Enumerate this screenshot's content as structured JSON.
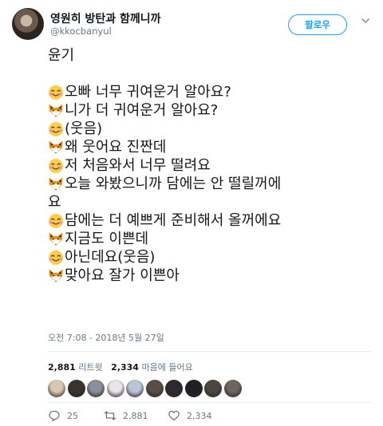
{
  "user": {
    "display_name": "영원히 방탄과 함께니까",
    "handle": "@kkocbanyul",
    "follow_label": "팔로우"
  },
  "tweet": {
    "lines": [
      {
        "icon": "",
        "text": "윤기"
      },
      {
        "icon": "",
        "text": ""
      },
      {
        "icon": "smiling-face-icon",
        "text": "오빠 너무 귀여운거 알아요?"
      },
      {
        "icon": "fox-face-icon",
        "text": "니가 더 귀여운거 알아요?"
      },
      {
        "icon": "smiling-face-icon",
        "text": "(웃음)"
      },
      {
        "icon": "fox-face-icon",
        "text": "왜 웃어요 진짠데"
      },
      {
        "icon": "smiling-face-icon",
        "text": "저 처음와서 너무 떨려요"
      },
      {
        "icon": "fox-face-icon",
        "text": "오늘 와봤으니까 담에는 안 떨릴꺼에"
      },
      {
        "icon": "",
        "text": "요"
      },
      {
        "icon": "smiling-face-icon",
        "text": "담에는 더 예쁘게 준비해서 올꺼에요"
      },
      {
        "icon": "fox-face-icon",
        "text": "지금도 이쁜데"
      },
      {
        "icon": "smiling-face-icon",
        "text": "아닌데요(웃음)"
      },
      {
        "icon": "fox-face-icon",
        "text": "맞아요 잘가 이쁜아"
      }
    ],
    "timestamp": "오전 7:08 - 2018년 5월 27일"
  },
  "stats": {
    "retweet_count": "2,881",
    "retweet_label": "리트윗",
    "like_count": "2,334",
    "like_label": "마음에 들어요"
  },
  "likers": [
    {
      "color": "#d9c7b3"
    },
    {
      "color": "#3b3330"
    },
    {
      "color": "#8a8f9c"
    },
    {
      "color": "#e9e4e8"
    },
    {
      "color": "#b9c6d8"
    },
    {
      "color": "#5c4d44"
    },
    {
      "color": "#2c2a30"
    },
    {
      "color": "#1f1f24"
    },
    {
      "color": "#4d4540"
    },
    {
      "color": "#6e6560"
    }
  ],
  "actions": {
    "reply_count": "25",
    "retweet_count": "2,881",
    "like_count": "2,334"
  },
  "colors": {
    "accent": "#1da1f2",
    "secondary_text": "#657786",
    "divider": "#e6ecf0"
  }
}
